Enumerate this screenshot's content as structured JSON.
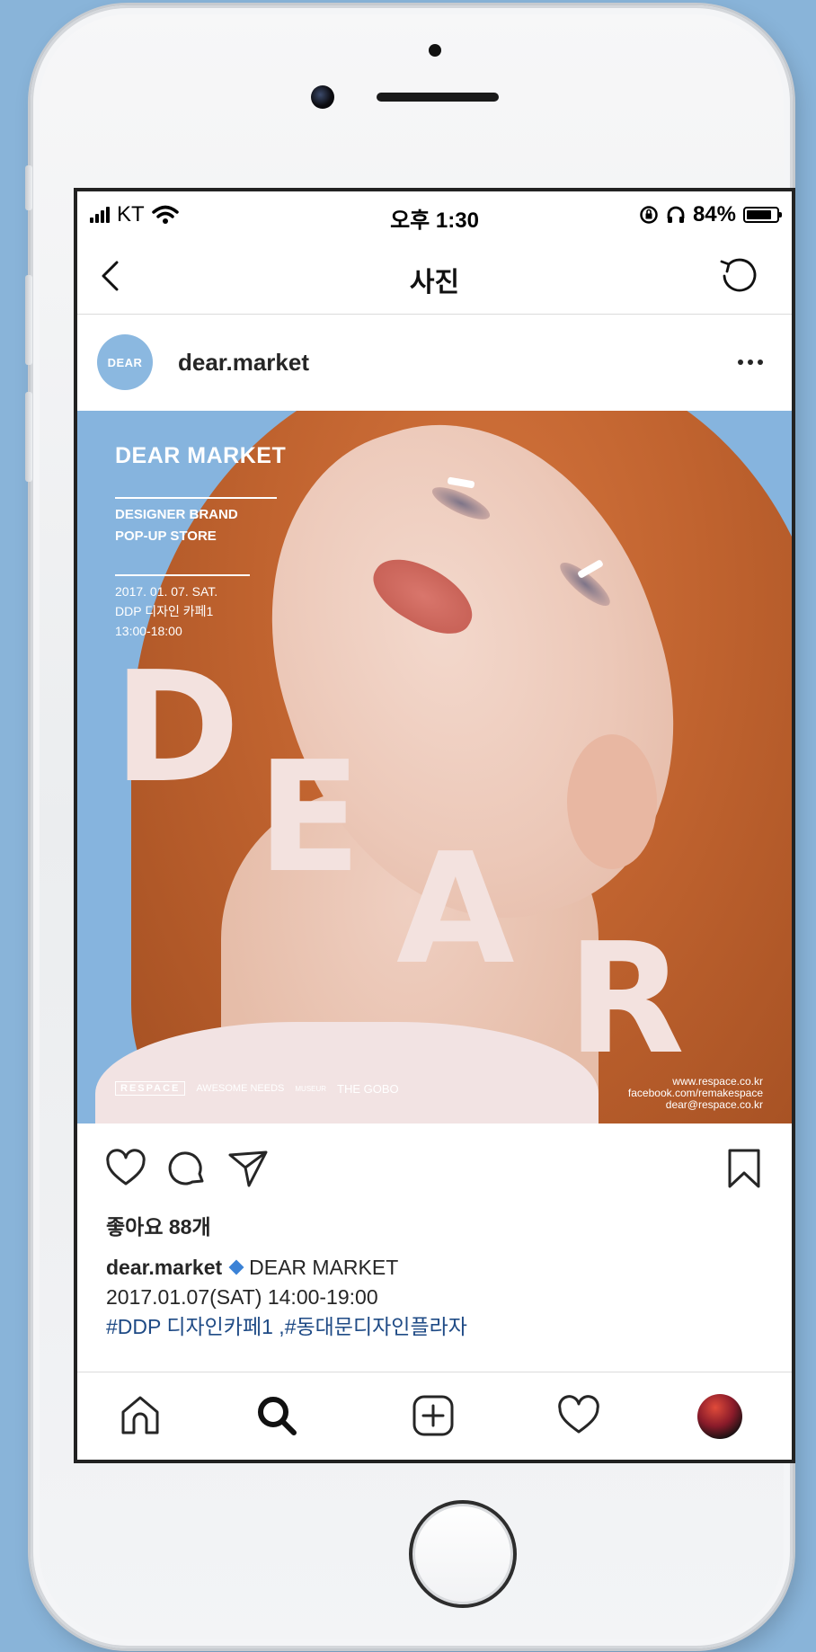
{
  "status_bar": {
    "carrier": "KT",
    "time": "오후 1:30",
    "battery_percent": "84%",
    "battery_level": 0.84,
    "icons": [
      "signal-icon",
      "wifi-icon",
      "rotation-lock-icon",
      "headphones-icon",
      "battery-icon"
    ]
  },
  "nav": {
    "title": "사진",
    "back_icon": "chevron-left-icon",
    "refresh_icon": "refresh-icon"
  },
  "post": {
    "avatar_text": "DEAR",
    "username": "dear.market",
    "more_icon": "more-icon"
  },
  "image": {
    "headline": "DEAR MARKET",
    "subtitle_line1": "DESIGNER BRAND",
    "subtitle_line2": "POP-UP STORE",
    "date_line": "2017. 01. 07. SAT.",
    "venue_line": "DDP 디자인 카페1",
    "hours_line": "13:00-18:00",
    "letters": [
      "D",
      "E",
      "A",
      "R"
    ],
    "sponsors": [
      "RESPACE",
      "AWESOME NEEDS",
      "MUSEUR",
      "THE GOBO"
    ],
    "contact_web": "www.respace.co.kr",
    "contact_fb": "facebook.com/remakespace",
    "contact_mail": "dear@respace.co.kr"
  },
  "actions": {
    "like_icon": "heart-icon",
    "comment_icon": "comment-icon",
    "share_icon": "send-icon",
    "save_icon": "bookmark-icon"
  },
  "likes_text": "좋아요 88개",
  "caption": {
    "username": "dear.market",
    "title": "DEAR MARKET",
    "line2": "2017.01.07(SAT) 14:00-19:00",
    "tags": "#DDP 디자인카페1 ,#동대문디자인플라자"
  },
  "tabbar": {
    "items": [
      "home-icon",
      "search-icon",
      "add-post-icon",
      "activity-heart-icon",
      "profile-avatar"
    ]
  },
  "colors": {
    "background": "#89b4d9",
    "poster_blue": "#86b4de",
    "hashtag": "#1e4a85",
    "diamond": "#3b82d6"
  }
}
